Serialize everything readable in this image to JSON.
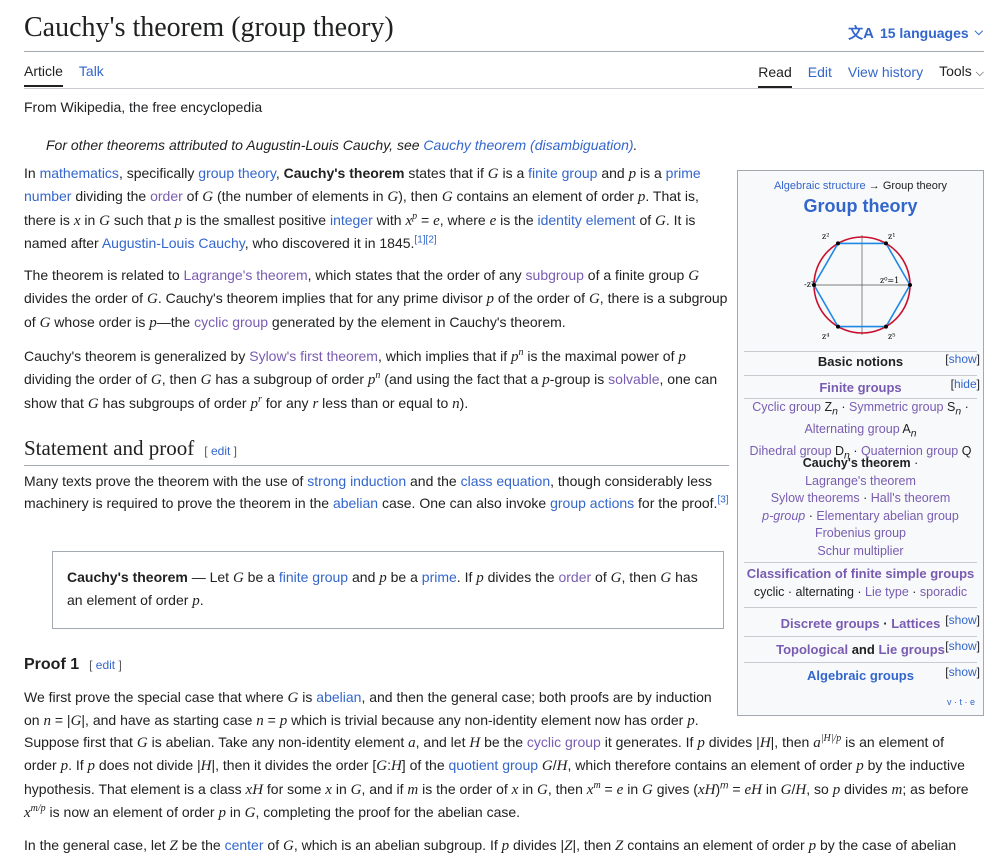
{
  "page": {
    "title": "Cauchy's theorem (group theory)",
    "languages": "15 languages",
    "tabs_left": [
      "Article",
      "Talk"
    ],
    "tabs_right": [
      "Read",
      "Edit",
      "View history",
      "Tools"
    ],
    "tagline": "From Wikipedia, the free encyclopedia",
    "hatnote_prefix": "For other theorems attributed to Augustin-Louis Cauchy, see ",
    "hatnote_link": "Cauchy theorem (disambiguation)",
    "hatnote_suffix": "."
  },
  "sections": {
    "statement": "Statement and proof",
    "proof1": "Proof 1",
    "edit": "edit"
  },
  "theorem_box": {
    "label": "Cauchy's theorem",
    "dash": " — Let ",
    "t1": " be a ",
    "link1": "finite group",
    "t2": " and ",
    "t3": " be a ",
    "link2": "prime",
    "t4": ". If ",
    "t5": " divides the ",
    "link3": "order",
    "t6": " of ",
    "t7": ", then ",
    "t8": " has an element of order ",
    "t9": "."
  },
  "navbox": {
    "crumb_link": "Algebraic structure",
    "crumb_arrow": " → ",
    "crumb_current": "Group theory",
    "title": "Group theory",
    "basic": "Basic notions",
    "finite": "Finite groups",
    "show": "show",
    "hide": "hide",
    "classification": "Classification of finite simple groups",
    "discrete": "Discrete groups",
    "lattices": "Lattices",
    "topological": "Topological",
    "and": " and ",
    "lie_groups": "Lie groups",
    "algebraic": "Algebraic groups",
    "vte": "v · t · e",
    "items": {
      "cyclic": "Cyclic group",
      "symmetric": "Symmetric group",
      "alternating": "Alternating group",
      "dihedral": "Dihedral group",
      "quaternion": "Quaternion group",
      "cauchy": "Cauchy's theorem",
      "lagrange": "Lagrange's theorem",
      "sylow": "Sylow theorems",
      "hall": "Hall's theorem",
      "pgroup": "p-group",
      "elem": "Elementary abelian group",
      "frobenius": "Frobenius group",
      "schur": "Schur multiplier",
      "cls_cyclic": "cyclic",
      "cls_alt": "alternating",
      "cls_lie": "Lie type",
      "cls_sporadic": "sporadic"
    },
    "hexagon_labels": [
      "z²",
      "z¹",
      "z⁰=1",
      "z⁵",
      "z⁴",
      "-z³"
    ]
  },
  "colors": {
    "link": "#3366cc",
    "visited": "#795cb2",
    "text": "#202122",
    "border": "#a2a9b1",
    "circle": "#c8102e",
    "hexagon": "#1e88e5"
  }
}
